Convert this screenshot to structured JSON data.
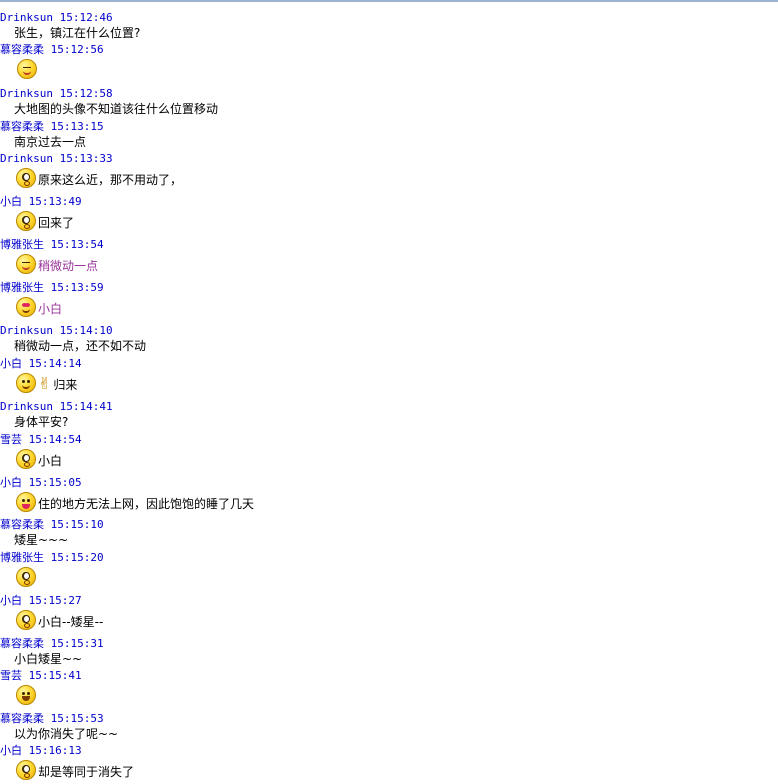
{
  "messages": [
    {
      "sender": "Drinksun",
      "time": "15:12:46",
      "text": "张生，镇江在什么位置?"
    },
    {
      "sender": "慕容柔柔",
      "time": "15:12:56",
      "emoticon": "squint-icon",
      "text": ""
    },
    {
      "sender": "Drinksun",
      "time": "15:12:58",
      "text": "大地图的头像不知道该往什么位置移动"
    },
    {
      "sender": "慕容柔柔",
      "time": "15:13:15",
      "text": "南京过去一点"
    },
    {
      "sender": "Drinksun",
      "time": "15:13:33",
      "emoticon": "surprised-icon",
      "text": "原来这么近，那不用动了，"
    },
    {
      "sender": "小白",
      "time": "15:13:49",
      "emoticon": "surprised-icon",
      "text": "回来了"
    },
    {
      "sender": "博雅张生",
      "time": "15:13:54",
      "emoticon": "squint-icon",
      "text": "稍微动一点"
    },
    {
      "sender": "博雅张生",
      "time": "15:13:59",
      "emoticon": "heart-eyes-icon",
      "text": "小白"
    },
    {
      "sender": "Drinksun",
      "time": "15:14:10",
      "text": "稍微动一点，还不如不动"
    },
    {
      "sender": "小白",
      "time": "15:14:14",
      "emoticon": "smile-icon",
      "emoticon2": "victory-hand-icon",
      "text": "归来"
    },
    {
      "sender": "Drinksun",
      "time": "15:14:41",
      "text": "身体平安?"
    },
    {
      "sender": "雪芸",
      "time": "15:14:54",
      "emoticon": "surprised-icon",
      "text": "小白"
    },
    {
      "sender": "小白",
      "time": "15:15:05",
      "emoticon": "tongue-icon",
      "text": "住的地方无法上网，因此饱饱的睡了几天"
    },
    {
      "sender": "慕容柔柔",
      "time": "15:15:10",
      "text": "矮星~~~"
    },
    {
      "sender": "博雅张生",
      "time": "15:15:20",
      "emoticon": "surprised-icon",
      "text": ""
    },
    {
      "sender": "小白",
      "time": "15:15:27",
      "emoticon": "surprised-icon",
      "text": "小白--矮星--"
    },
    {
      "sender": "慕容柔柔",
      "time": "15:15:31",
      "text": "小白矮星~~"
    },
    {
      "sender": "雪芸",
      "time": "15:15:41",
      "emoticon": "laugh-icon",
      "text": ""
    },
    {
      "sender": "慕容柔柔",
      "time": "15:15:53",
      "text": "以为你消失了呢~~"
    },
    {
      "sender": "小白",
      "time": "15:16:13",
      "emoticon": "surprised-icon",
      "text": "却是等同于消失了"
    }
  ],
  "colors": {
    "header": "#0000cc",
    "message": "#000000",
    "purple": "#993399",
    "top_border": "#9bb3cf"
  }
}
